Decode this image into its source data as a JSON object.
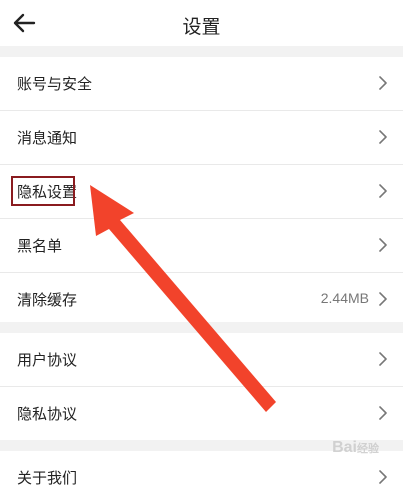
{
  "header": {
    "title": "设置",
    "back_icon": "arrow-left-icon"
  },
  "groups": [
    {
      "items": [
        {
          "label": "账号与安全",
          "value": "",
          "icon": "chevron-right-icon"
        },
        {
          "label": "消息通知",
          "value": "",
          "icon": "chevron-right-icon"
        },
        {
          "label": "隐私设置",
          "value": "",
          "icon": "chevron-right-icon"
        },
        {
          "label": "黑名单",
          "value": "",
          "icon": "chevron-right-icon"
        },
        {
          "label": "清除缓存",
          "value": "2.44MB",
          "icon": "chevron-right-icon"
        }
      ]
    },
    {
      "items": [
        {
          "label": "用户协议",
          "value": "",
          "icon": "chevron-right-icon"
        },
        {
          "label": "隐私协议",
          "value": "",
          "icon": "chevron-right-icon"
        }
      ]
    },
    {
      "items": [
        {
          "label": "关于我们",
          "value": "",
          "icon": "chevron-right-icon"
        }
      ]
    }
  ],
  "annotation": {
    "highlight_target": "隐私设置",
    "arrow_color": "#f2432b",
    "box_color": "#8a1b1f"
  },
  "watermark": {
    "text": "Bai",
    "sub": "经验"
  }
}
